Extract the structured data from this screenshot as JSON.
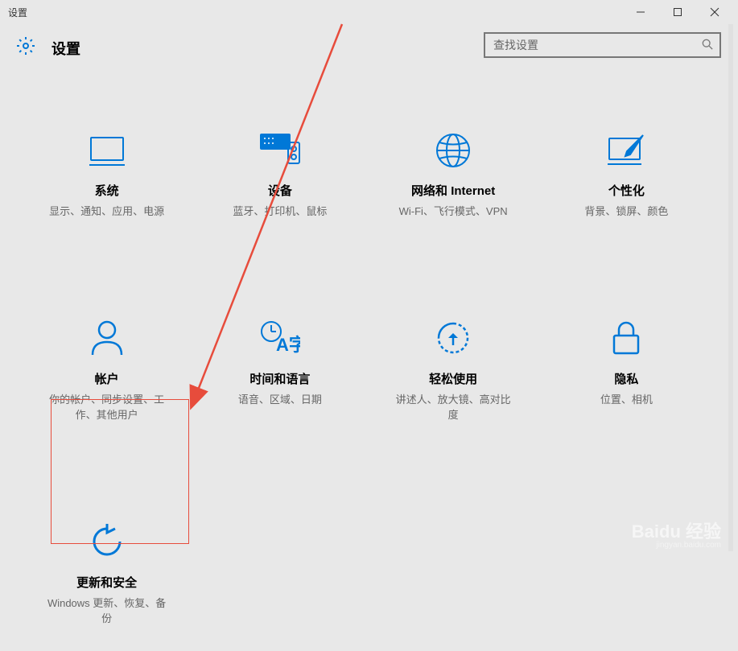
{
  "window": {
    "title": "设置"
  },
  "header": {
    "title": "设置"
  },
  "search": {
    "placeholder": "查找设置"
  },
  "tiles": {
    "system": {
      "title": "系统",
      "desc": "显示、通知、应用、电源"
    },
    "devices": {
      "title": "设备",
      "desc": "蓝牙、打印机、鼠标"
    },
    "network": {
      "title": "网络和 Internet",
      "desc": "Wi-Fi、飞行模式、VPN"
    },
    "personalization": {
      "title": "个性化",
      "desc": "背景、锁屏、颜色"
    },
    "accounts": {
      "title": "帐户",
      "desc": "你的帐户、同步设置、工作、其他用户"
    },
    "time": {
      "title": "时间和语言",
      "desc": "语音、区域、日期"
    },
    "ease": {
      "title": "轻松使用",
      "desc": "讲述人、放大镜、高对比度"
    },
    "privacy": {
      "title": "隐私",
      "desc": "位置、相机"
    },
    "update": {
      "title": "更新和安全",
      "desc": "Windows 更新、恢复、备份"
    }
  },
  "colors": {
    "icon": "#0078d7",
    "highlight": "#e74c3c"
  },
  "watermark": {
    "main": "Baidu 经验",
    "sub": "jingyan.baidu.com"
  }
}
